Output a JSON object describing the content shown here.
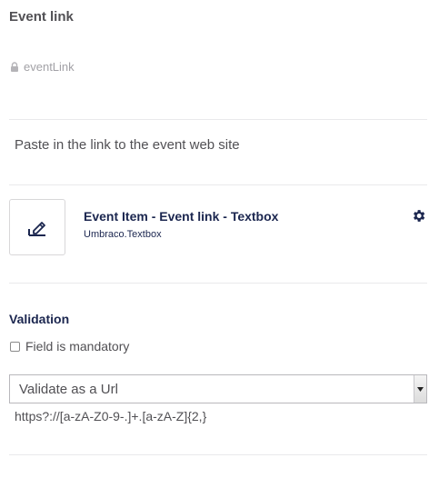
{
  "property": {
    "name": "Event link",
    "alias": "eventLink",
    "description": "Paste in the link to the event web site"
  },
  "editor": {
    "name": "Event Item - Event link - Textbox",
    "alias": "Umbraco.Textbox",
    "icon": "pencil-edit-icon",
    "settings_icon": "gear-icon"
  },
  "validation": {
    "title": "Validation",
    "mandatory_label": "Field is mandatory",
    "mandatory_checked": false,
    "selected_option": "Validate as a Url",
    "regex": "https?://[a-zA-Z0-9-.]+.[a-zA-Z]{2,}"
  },
  "colors": {
    "text": "#515054",
    "heading": "#1b264f",
    "muted": "#a2a1a6",
    "divider": "#e9e9eb"
  }
}
